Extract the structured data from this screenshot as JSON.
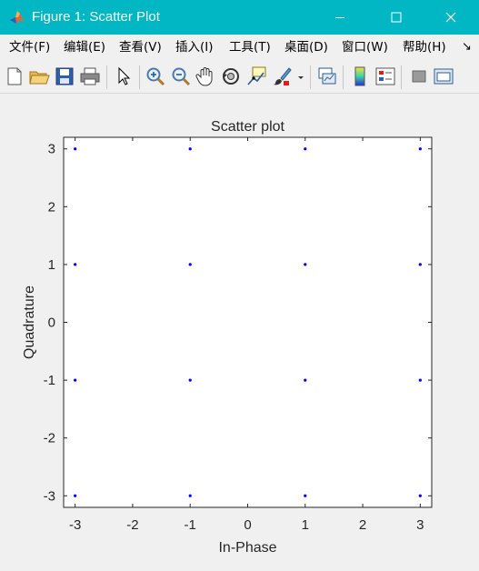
{
  "window": {
    "title": "Figure 1: Scatter Plot",
    "controls": [
      "minimize",
      "maximize",
      "close"
    ]
  },
  "menu": [
    {
      "label": "文件(F)"
    },
    {
      "label": "编辑(E)"
    },
    {
      "label": "查看(V)"
    },
    {
      "label": "插入(I)"
    },
    {
      "label": "工具(T)"
    },
    {
      "label": "桌面(D)"
    },
    {
      "label": "窗口(W)"
    },
    {
      "label": "帮助(H)"
    }
  ],
  "toolbar_icons": [
    "new-figure-icon",
    "open-file-icon",
    "save-icon",
    "print-icon",
    "select-arrow-icon",
    "zoom-in-icon",
    "zoom-out-icon",
    "pan-hand-icon",
    "rotate-3d-icon",
    "data-cursor-icon",
    "brush-icon",
    "brush-dropdown-icon",
    "link-plot-icon",
    "insert-colorbar-icon",
    "insert-legend-icon",
    "hide-plot-tools-icon",
    "show-plot-tools-icon"
  ],
  "chart_data": {
    "type": "scatter",
    "title": "Scatter plot",
    "xlabel": "In-Phase",
    "ylabel": "Quadrature",
    "xlim": [
      -3.2,
      3.2
    ],
    "ylim": [
      -3.2,
      3.2
    ],
    "xticks": [
      -3,
      -2,
      -1,
      0,
      1,
      2,
      3
    ],
    "yticks": [
      -3,
      -2,
      -1,
      0,
      1,
      2,
      3
    ],
    "grid": false,
    "marker_color": "#0000ff",
    "series": [
      {
        "x": [
          -3,
          -1,
          1,
          3,
          -3,
          -1,
          1,
          3,
          -3,
          -1,
          1,
          3,
          -3,
          -1,
          1,
          3
        ],
        "y": [
          3,
          3,
          3,
          3,
          1,
          1,
          1,
          1,
          -1,
          -1,
          -1,
          -1,
          -3,
          -3,
          -3,
          -3
        ]
      }
    ]
  },
  "colors": {
    "titlebar": "#00b7c3",
    "background": "#f0f0f0"
  }
}
